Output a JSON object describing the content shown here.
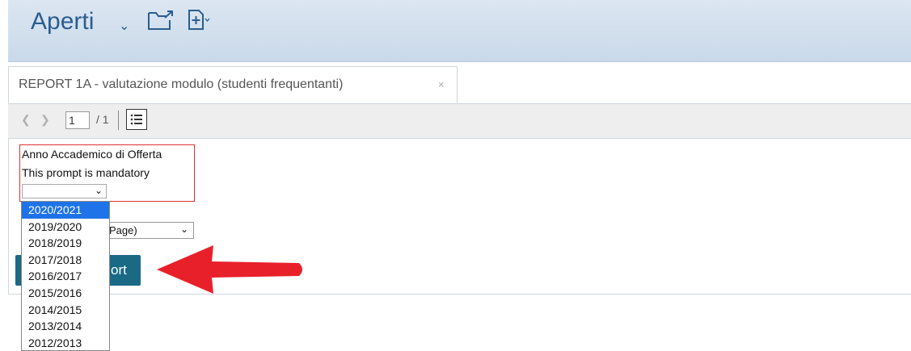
{
  "header": {
    "title": "Aperti",
    "icons": [
      "chevron-down-icon",
      "open-folder-icon",
      "new-document-icon"
    ]
  },
  "tabs": [
    {
      "label": "REPORT 1A - valutazione modulo (studenti frequentanti)",
      "close": "×"
    }
  ],
  "toolbar": {
    "page_value": "1",
    "page_total": "/ 1"
  },
  "prompt": {
    "title": "Anno Accademico di Offerta",
    "mandatory_text": "This prompt is mandatory",
    "selected_value": ""
  },
  "dropdown": {
    "options": [
      "2020/2021",
      "2019/2020",
      "2018/2019",
      "2017/2018",
      "2016/2017",
      "2015/2016",
      "2014/2015",
      "2013/2014",
      "2012/2013"
    ],
    "highlighted": "2020/2021"
  },
  "format_select": {
    "visible_label": "Page)"
  },
  "run_button": {
    "visible_label": "ort"
  },
  "colors": {
    "header_bg": "#c9d9ea",
    "accent": "#2a5d8f",
    "button": "#1a6a86",
    "highlight": "#1e73e8",
    "prompt_border": "#e03030",
    "annotation_arrow": "#e8202a"
  }
}
